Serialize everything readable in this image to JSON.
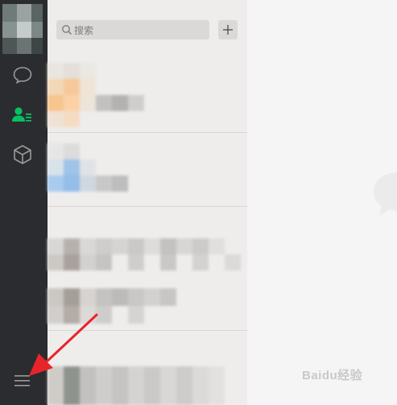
{
  "search": {
    "placeholder": "搜索"
  },
  "icons": {
    "chat": "chat-bubble-icon",
    "contacts": "contacts-icon",
    "favorites": "cube-icon",
    "menu": "hamburger-menu-icon",
    "add": "plus-icon",
    "search": "search-icon"
  },
  "colors": {
    "rail_bg": "#2b2c2f",
    "active_icon": "#07c160",
    "arrow": "#e8242b"
  },
  "watermark": {
    "text": "Baidu经验"
  }
}
